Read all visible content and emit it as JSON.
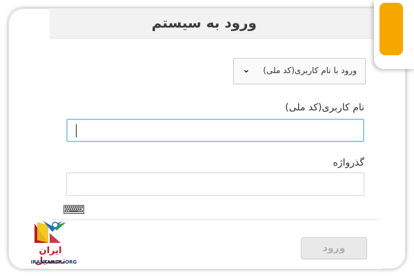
{
  "header": {
    "title": "ورود به سیستم"
  },
  "login_method": {
    "selected": "ورود با نام کاربری(کد ملی)"
  },
  "username": {
    "label": "نام کاربری(کد ملی)",
    "value": ""
  },
  "password": {
    "label": "گذرواژه",
    "value": ""
  },
  "submit": {
    "label": "ورود"
  },
  "watermark": {
    "title": "ایران تحصیل",
    "site": "IRANTAHSIL.ORG"
  },
  "colors": {
    "accent_tab": "#f7a600",
    "focus_border": "#9ec9e8",
    "brand_red": "#b81d24",
    "brand_blue": "#0d3b6e"
  },
  "icons": {
    "select": "chevron-down-icon",
    "keyboard": "keyboard-icon"
  }
}
